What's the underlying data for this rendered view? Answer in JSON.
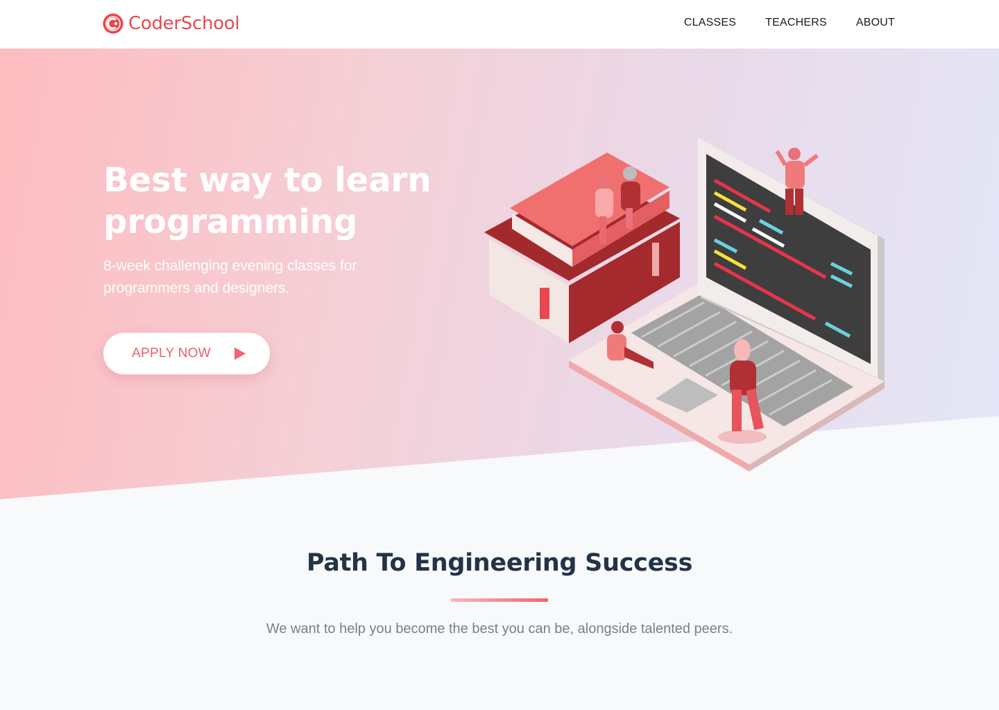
{
  "brand": {
    "name": "CoderSchool",
    "color": "#e8484c",
    "icon": "coderschool-logo-icon"
  },
  "nav": {
    "items": [
      "CLASSES",
      "TEACHERS",
      "ABOUT"
    ]
  },
  "hero": {
    "title": "Best way to learn programming",
    "subtitle": "8-week challenging evening classes for programmers and designers.",
    "cta_label": "APPLY NOW",
    "cta_icon": "play-arrow-icon",
    "illustration": "isometric-laptop-books-people-illustration",
    "gradient": [
      "#fdbcbf",
      "#f5cfd6",
      "#ead9e8",
      "#e3e7f8"
    ]
  },
  "path_section": {
    "title": "Path To Engineering Success",
    "subtitle": "We want to help you become the best you can be, alongside talented peers.",
    "accent_gradient": [
      "#f8b6b9",
      "#f0646c"
    ]
  },
  "colors": {
    "accent": "#e8606a",
    "heading": "#243447",
    "body_text": "#7a7f85"
  }
}
